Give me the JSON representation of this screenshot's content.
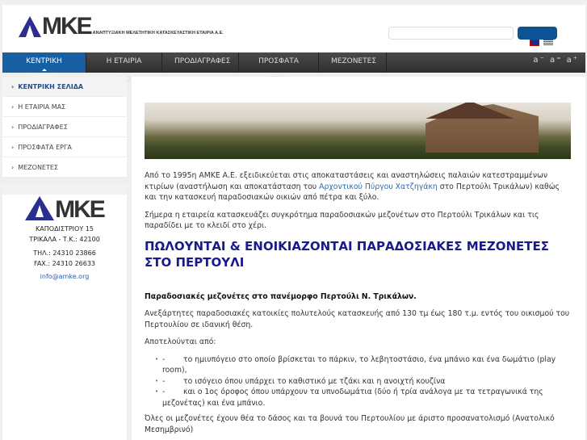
{
  "header": {
    "logo_text": "MKE",
    "tagline": "ΑΝΑΠΤΥΞΙΑΚΗ ΜΕΛΕΤΗΤΙΚΗ ΚΑΤΑΣΚΕΥΑΣΤΙΚΗ ΕΤΑΙΡΙΑ Α.Ε.",
    "search_placeholder": ""
  },
  "nav": {
    "items": [
      "ΚΕΝΤΡΙΚΗ ΣΕΛΙΔΑ",
      "Η ΕΤΑΙΡΙΑ ΜΑΣ",
      "ΠΡΟΔΙΑΓΡΑΦΕΣ",
      "ΠΡΟΣΦΑΤΑ ΕΡΓΑ",
      "ΜΕΖΟΝΕΤΕΣ"
    ],
    "font_sizes": "a⁻ a⁼ a⁺"
  },
  "sidebar": {
    "items": [
      "ΚΕΝΤΡΙΚΗ ΣΕΛΙΔΑ",
      "Η ΕΤΑΙΡΙΑ ΜΑΣ",
      "ΠΡΟΔΙΑΓΡΑΦΕΣ",
      "ΠΡΟΣΦΑΤΑ ΕΡΓΑ",
      "ΜΕΖΟΝΕΤΕΣ"
    ]
  },
  "contact": {
    "logo_text": "MKE",
    "address": "ΚΑΠΟΔΙΣΤΡΙΟΥ 15",
    "city": "ΤΡΙΚΑΛΑ - Τ.Κ.: 42100",
    "phone": "ΤΗΛ.: 24310 23866",
    "fax": "FAX.: 24310 26633",
    "email": "info@amke.org"
  },
  "main": {
    "p1_a": "Από το  1995η ΑΜΚΕ Α.Ε. εξειδικεύεται στις αποκαταστάσεις και αναστηλώσεις παλαιών κατεστραμμένων κτιρίων (αναστήλωση και αποκατάσταση του ",
    "p1_link": "Αρχοντικού Πύργου Χατζηγάκη",
    "p1_b": " στο Περτούλι Τρικάλων) καθώς και την κατασκευή παραδοσιακών οικιών από πέτρα και ξύλο.",
    "p2": "Σήμερα η εταιρεία κατασκευάζει συγκρότημα παραδοσιακών μεζονέτων στο Περτούλι Τρικάλων και τις παραδίδει με το κλειδί στο χέρι.",
    "heading": "ΠΩΛΟΥΝΤΑΙ & ΕΝΟΙΚΙΑΖΟΝΤΑΙ ΠΑΡΑΔΟΣΙΑΚΕΣ ΜΕΖΟΝΕΤΕΣ ΣΤΟ ΠΕΡΤΟΥΛΙ",
    "subheading": "Παραδοσιακές μεζονέτες στο πανέμορφο Περτούλι Ν. Τρικάλων.",
    "p3": "Ανεξάρτητες παραδοσιακές κατοικίες πολυτελούς κατασκευής από 130 τμ έως 180 τ.μ. εντός του οικισμού του Περτουλίου σε ιδανική θέση.",
    "p4": "Αποτελούνται από:",
    "list": [
      "το ημιυπόγειο στο οποίο βρίσκεται το πάρκιν, το λεβητοστάσιο, ένα μπάνιο και ένα δωμάτιο (play room),",
      "το ισόγειο όπου υπάρχει το καθιστικό με τζάκι και η ανοιχτή κουζίνα",
      "και ο 1ος όροφος όπου υπάρχουν τα υπνοδωμάτια (δύο ή τρία ανάλογα με τα τετραγωνικά της μεζονέτας) και ένα μπάνιο."
    ],
    "list_dash": "-",
    "p5": " Όλες οι μεζονέτες έχουν θέα το δάσος και τα βουνά του Περτουλίου με άριστο προσανατολισμό (Ανατολικό Μεσημβρινό)"
  }
}
